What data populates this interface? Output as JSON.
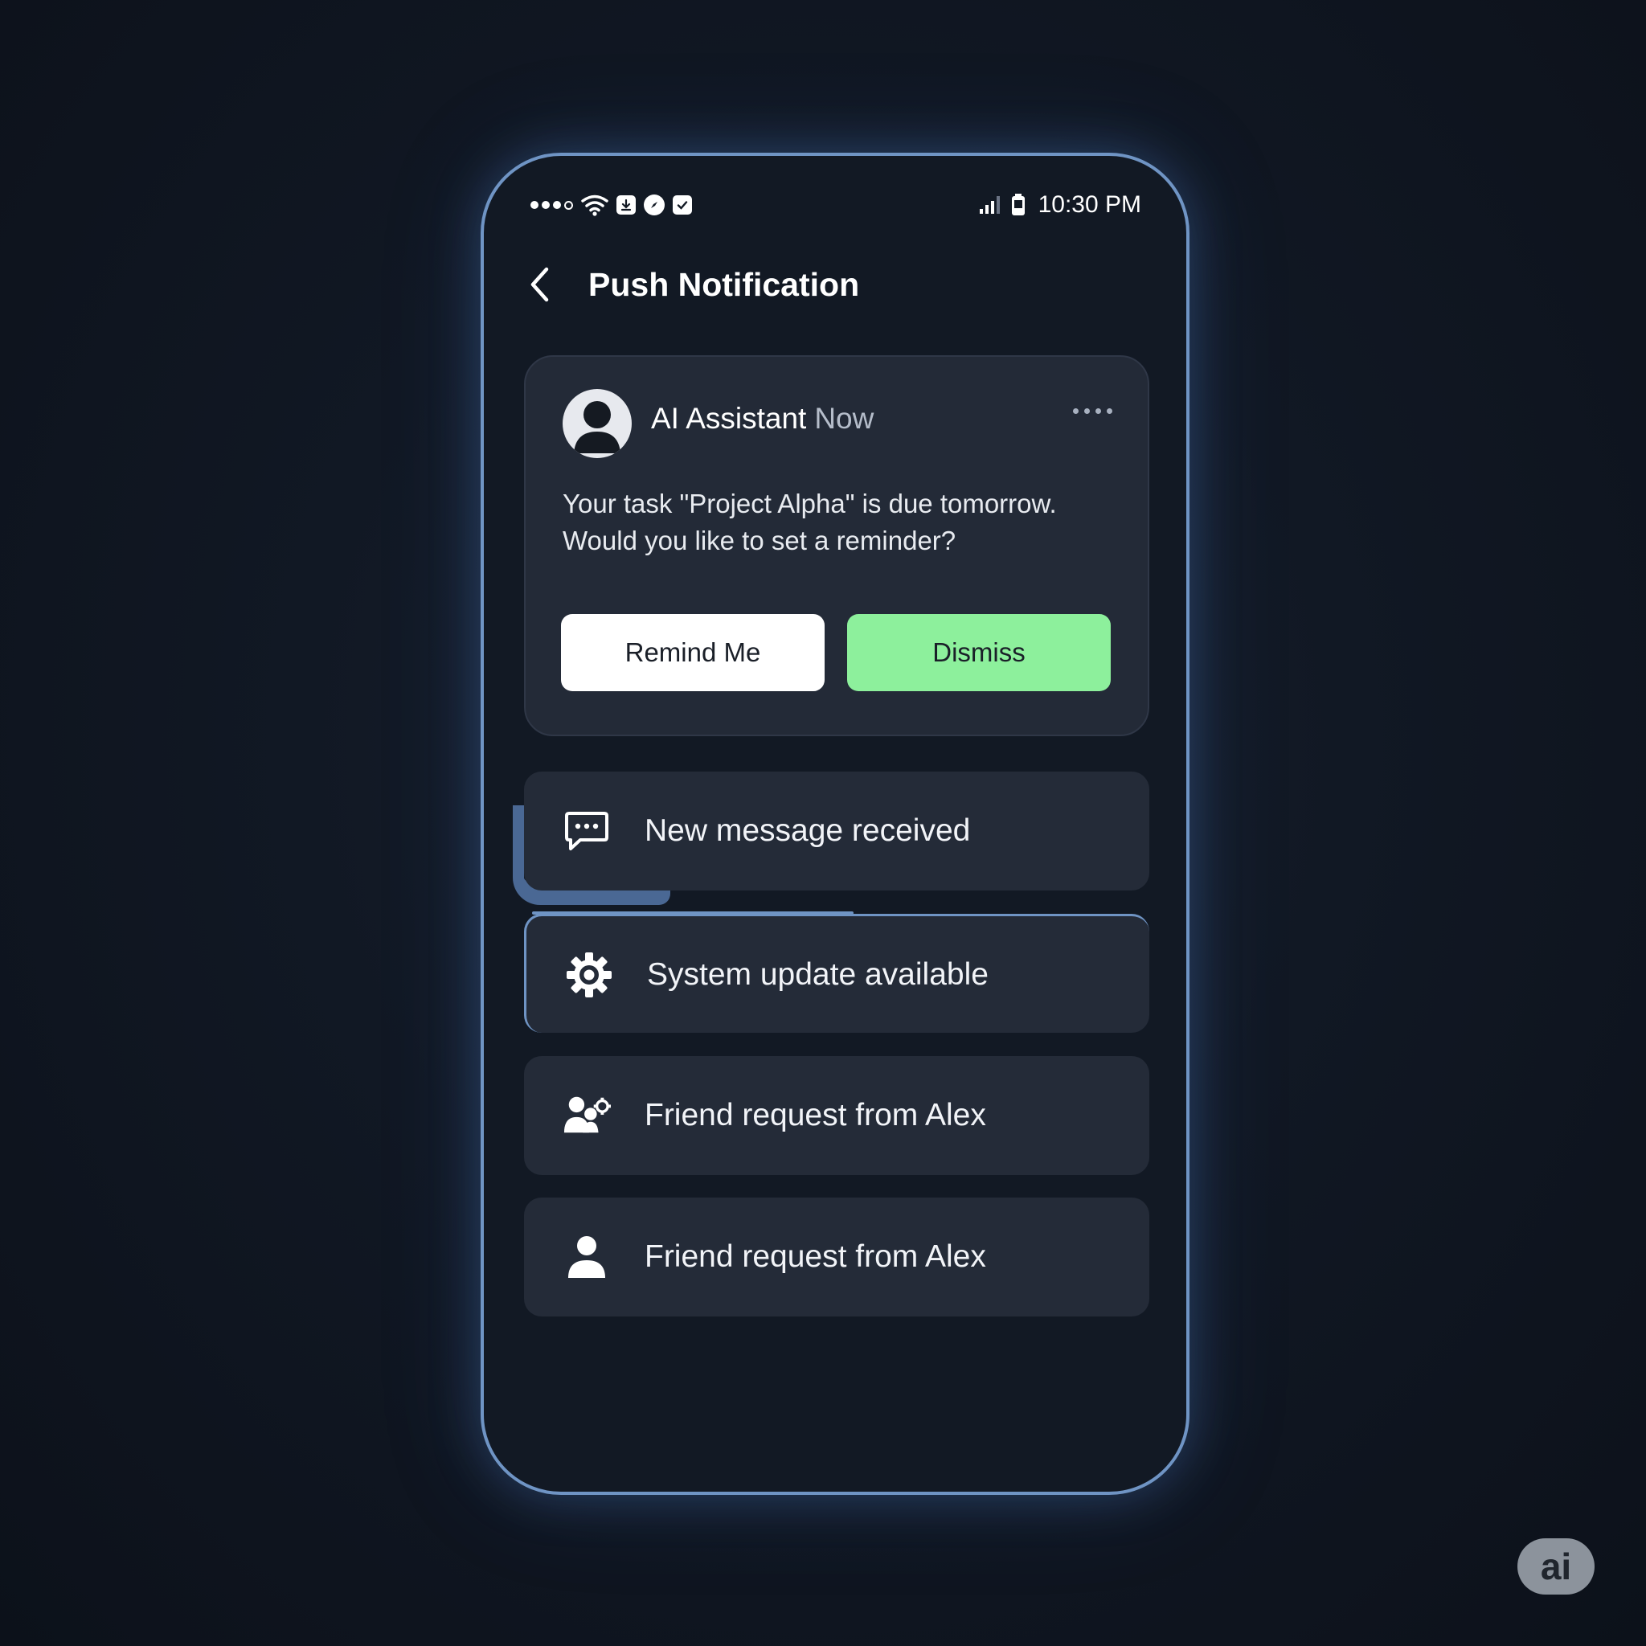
{
  "status_bar": {
    "time": "10:30 PM"
  },
  "header": {
    "title": "Push Notification"
  },
  "notification": {
    "sender": "AI Assistant",
    "time": "Now",
    "body_line1": "Your task \"Project Alpha\" is due tomorrow.",
    "body_line2": "Would you like to set a reminder?",
    "primary_action": "Remind Me",
    "secondary_action": "Dismiss"
  },
  "list": {
    "items": [
      {
        "icon": "chat-bubble-icon",
        "label": "New message received"
      },
      {
        "icon": "gear-icon",
        "label": "System update available"
      },
      {
        "icon": "users-settings-icon",
        "label": "Friend request from Alex"
      },
      {
        "icon": "user-icon",
        "label": "Friend request from Alex"
      }
    ]
  },
  "watermark": {
    "text": "ai"
  },
  "colors": {
    "background": "#111824",
    "phone_border": "#6f94c4",
    "card": "#232a37",
    "dismiss_button": "#8df09c",
    "remind_button": "#ffffff"
  }
}
